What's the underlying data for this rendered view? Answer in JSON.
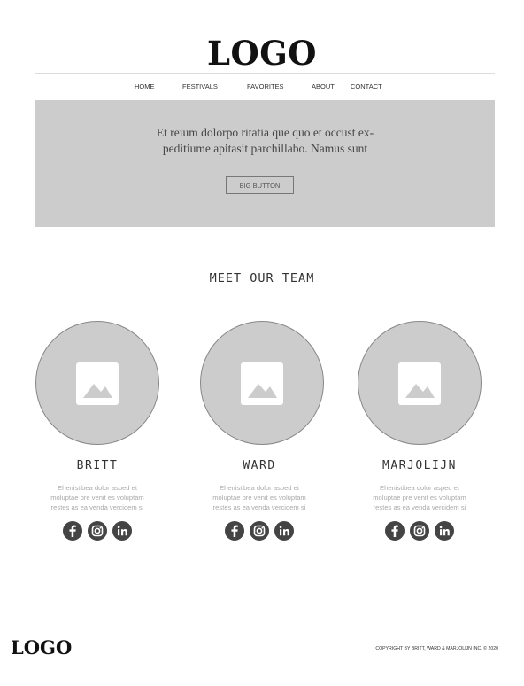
{
  "header": {
    "logo": "LOGO",
    "nav": [
      "HOME",
      "FESTIVALS",
      "FAVORITES",
      "ABOUT",
      "CONTACT"
    ]
  },
  "hero": {
    "text_line1": "Et reium dolorpo ritatia que quo et occust ex-",
    "text_line2": "peditiume apitasit parchillabo. Namus sunt",
    "button_label": "BIG BUTTON"
  },
  "team": {
    "title": "MEET OUR TEAM",
    "members": [
      {
        "name": "BRITT",
        "bio": [
          "Ehenistibea dolor asped et",
          "moluptae pre venit es voluptam",
          "restes as ea venda vercidem si"
        ],
        "icons": [
          "facebook-icon",
          "instagram-icon",
          "linkedin-icon"
        ]
      },
      {
        "name": "WARD",
        "bio": [
          "Ehenistibea dolor asped et",
          "moluptae pre venit es voluptam",
          "restes as ea venda vercidem si"
        ],
        "icons": [
          "facebook-icon",
          "instagram-icon",
          "linkedin-icon"
        ]
      },
      {
        "name": "MARJOLIJN",
        "bio": [
          "Ehenistibea dolor asped et",
          "moluptae pre venit es voluptam",
          "restes as ea venda vercidem si"
        ],
        "icons": [
          "facebook-icon",
          "instagram-icon",
          "linkedin-icon"
        ]
      }
    ]
  },
  "footer": {
    "logo": "LOGO",
    "copyright": "COPYRIGHT BY BRITT, WARD & MARJOLIJN INC. © 2020"
  },
  "colors": {
    "placeholder_gray": "#cccccc",
    "icon_dark": "#444444",
    "logo_black": "#111111"
  }
}
